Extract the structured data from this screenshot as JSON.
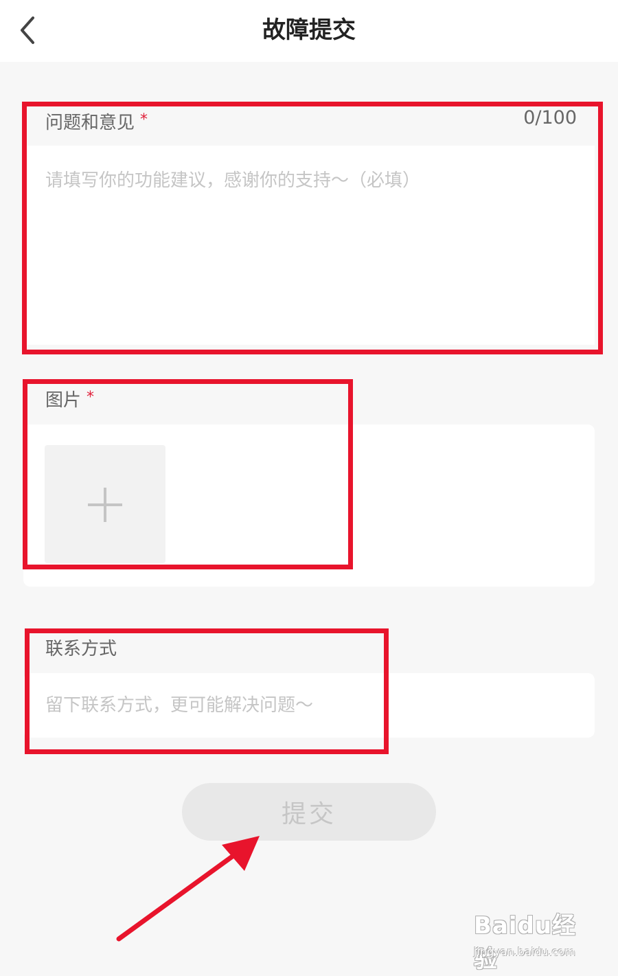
{
  "header": {
    "title": "故障提交",
    "back_icon": "chevron-left-icon"
  },
  "feedback": {
    "label": "问题和意见",
    "required_mark": "*",
    "counter": "0/100",
    "placeholder": "请填写你的功能建议，感谢你的支持～（必填）",
    "value": ""
  },
  "images": {
    "label": "图片",
    "required_mark": "*",
    "add_icon": "plus-icon"
  },
  "contact": {
    "label": "联系方式",
    "placeholder": "留下联系方式，更可能解决问题～",
    "value": ""
  },
  "submit": {
    "label": "提交"
  },
  "watermark": {
    "brand": "Baidu经验",
    "url": "jingyan.baidu.com"
  },
  "colors": {
    "highlight": "#e8142c",
    "required": "#e0203a",
    "background": "#f7f7f7",
    "button_bg": "#e8e8e8"
  }
}
